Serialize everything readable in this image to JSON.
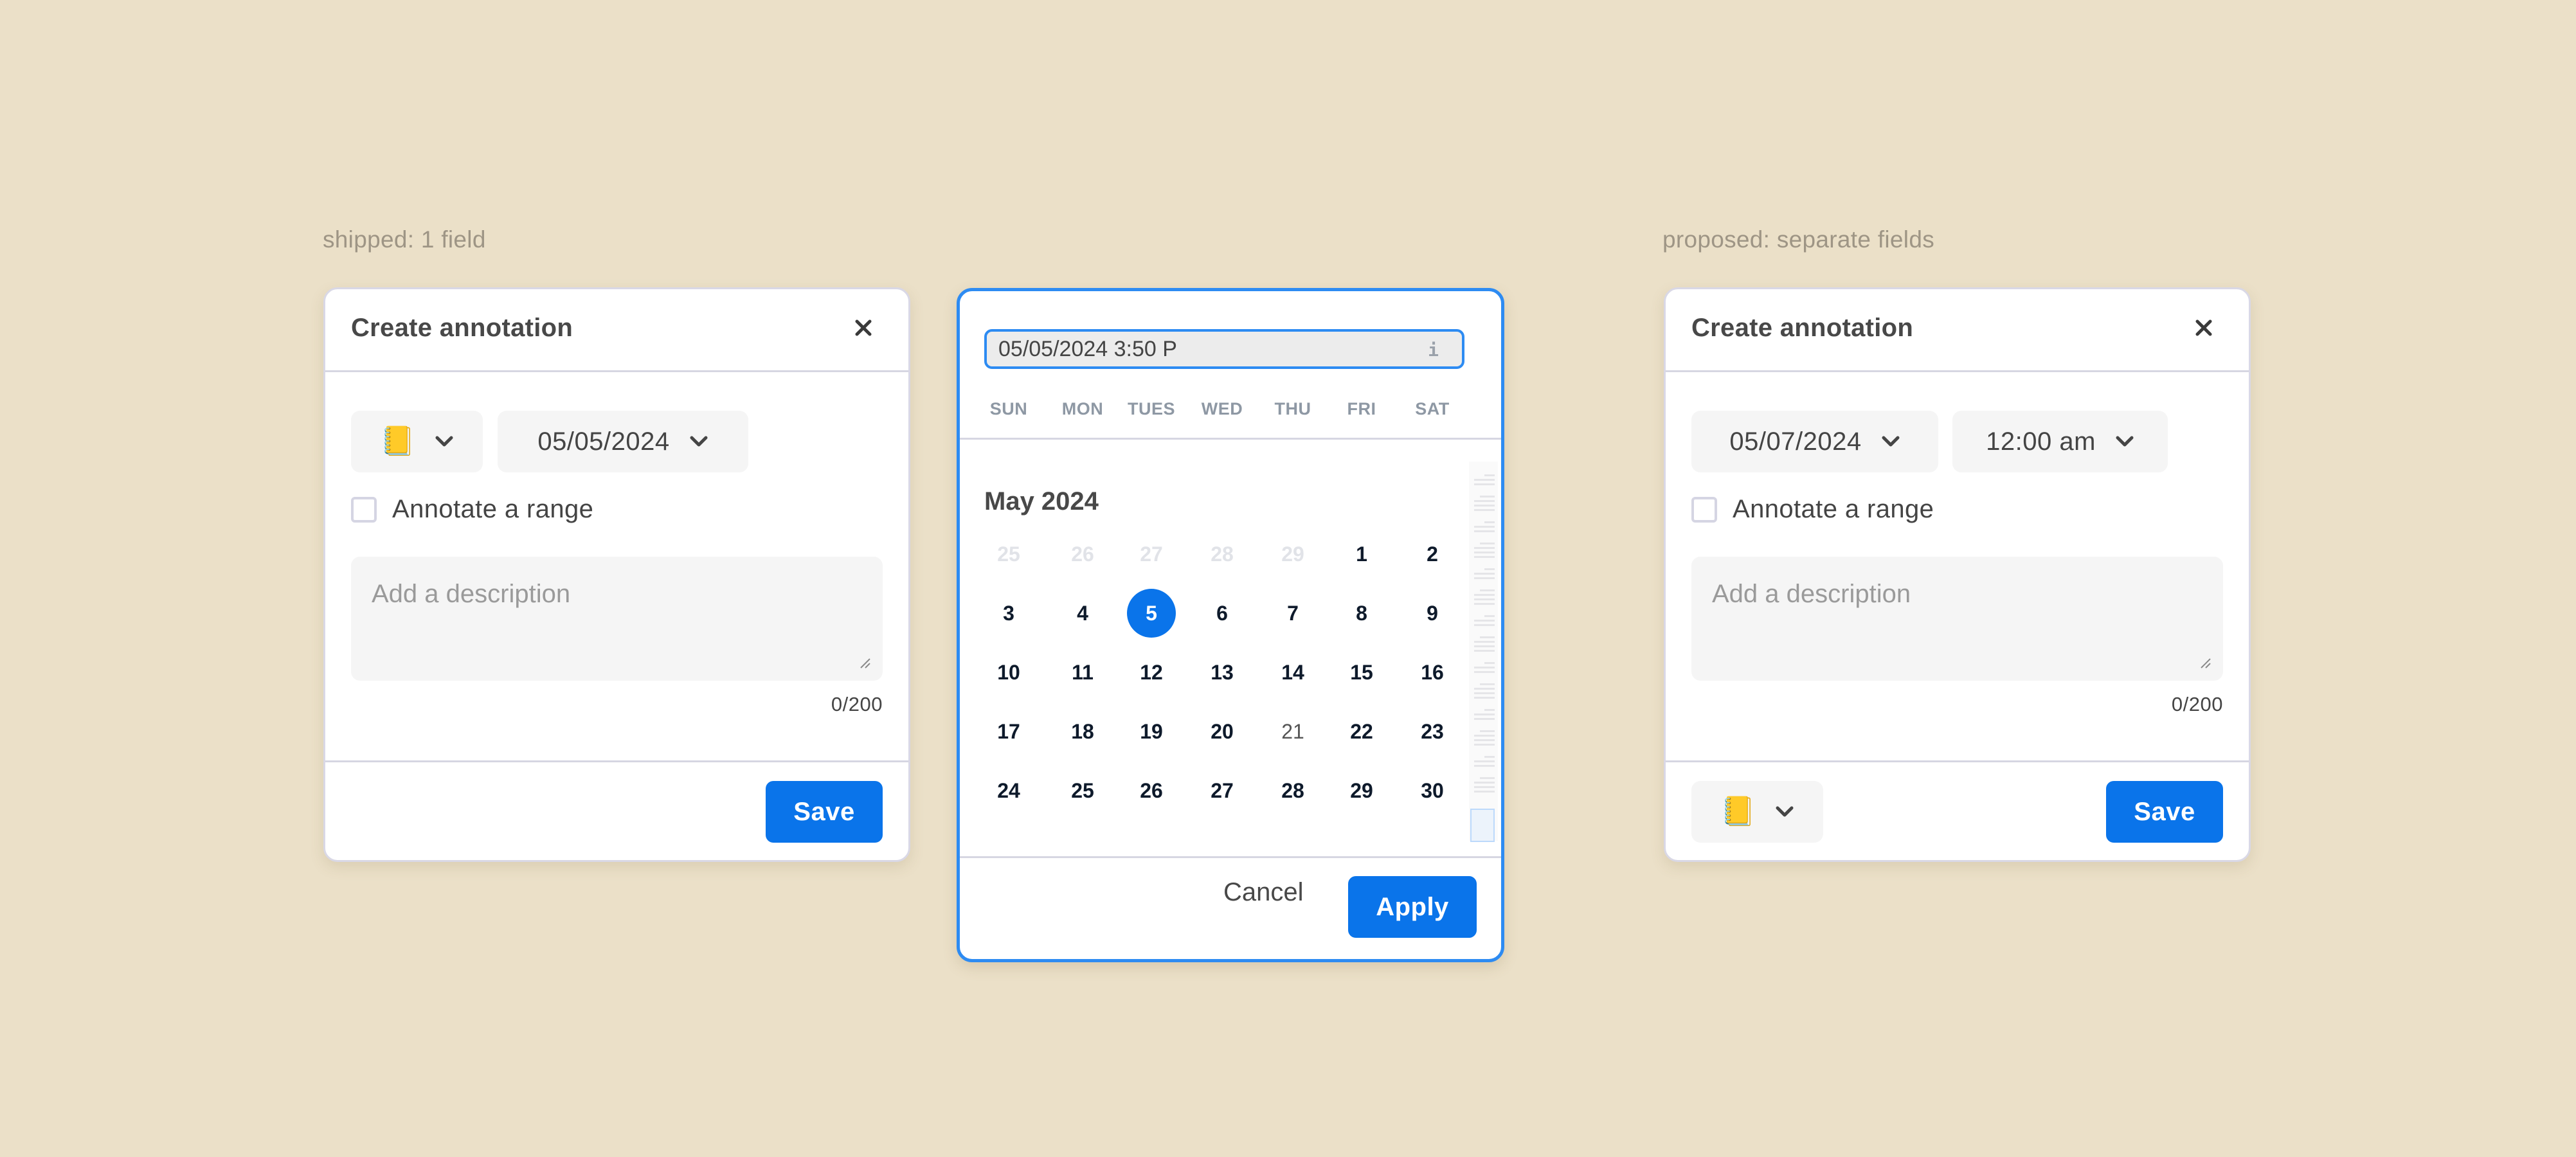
{
  "colors": {
    "background": "#ebe0c8",
    "accent": "#0a74ea",
    "focus_border": "#2d8bf2",
    "caption": "#9e9585"
  },
  "left": {
    "caption": "shipped: 1 field",
    "dialog": {
      "title": "Create annotation",
      "close_icon": "close-icon",
      "emoji_picker": {
        "emoji": "📒",
        "icon": "notebook-icon"
      },
      "date_select": {
        "value": "05/05/2024"
      },
      "range_checkbox": {
        "label": "Annotate a range",
        "checked": false
      },
      "description": {
        "placeholder": "Add a description",
        "value": ""
      },
      "counter": "0/200",
      "save_label": "Save"
    }
  },
  "picker": {
    "input_value": "05/05/2024 3:50 P",
    "info_glyph": "i",
    "weekdays": [
      "SUN",
      "MON",
      "TUES",
      "WED",
      "THU",
      "FRI",
      "SAT"
    ],
    "month_title": "May 2024",
    "selected_day": 5,
    "weeks": [
      [
        {
          "d": "25",
          "muted": true
        },
        {
          "d": "26",
          "muted": true
        },
        {
          "d": "27",
          "muted": true
        },
        {
          "d": "28",
          "muted": true
        },
        {
          "d": "29",
          "muted": true
        },
        {
          "d": "1"
        },
        {
          "d": "2"
        }
      ],
      [
        {
          "d": "3"
        },
        {
          "d": "4"
        },
        {
          "d": "5",
          "selected": true
        },
        {
          "d": "6"
        },
        {
          "d": "7"
        },
        {
          "d": "8"
        },
        {
          "d": "9"
        }
      ],
      [
        {
          "d": "10"
        },
        {
          "d": "11"
        },
        {
          "d": "12"
        },
        {
          "d": "13"
        },
        {
          "d": "14"
        },
        {
          "d": "15"
        },
        {
          "d": "16"
        }
      ],
      [
        {
          "d": "17"
        },
        {
          "d": "18"
        },
        {
          "d": "19"
        },
        {
          "d": "20"
        },
        {
          "d": "21",
          "dim": true
        },
        {
          "d": "22"
        },
        {
          "d": "23"
        }
      ],
      [
        {
          "d": "24"
        },
        {
          "d": "25"
        },
        {
          "d": "26"
        },
        {
          "d": "27"
        },
        {
          "d": "28"
        },
        {
          "d": "29"
        },
        {
          "d": "30"
        }
      ]
    ],
    "cancel_label": "Cancel",
    "apply_label": "Apply"
  },
  "right": {
    "caption": "proposed: separate fields",
    "dialog": {
      "title": "Create annotation",
      "close_icon": "close-icon",
      "date_select": {
        "value": "05/07/2024"
      },
      "time_select": {
        "value": "12:00 am"
      },
      "range_checkbox": {
        "label": "Annotate a range",
        "checked": false
      },
      "description": {
        "placeholder": "Add a description",
        "value": ""
      },
      "counter": "0/200",
      "emoji_picker": {
        "emoji": "📒",
        "icon": "notebook-icon"
      },
      "save_label": "Save"
    }
  }
}
